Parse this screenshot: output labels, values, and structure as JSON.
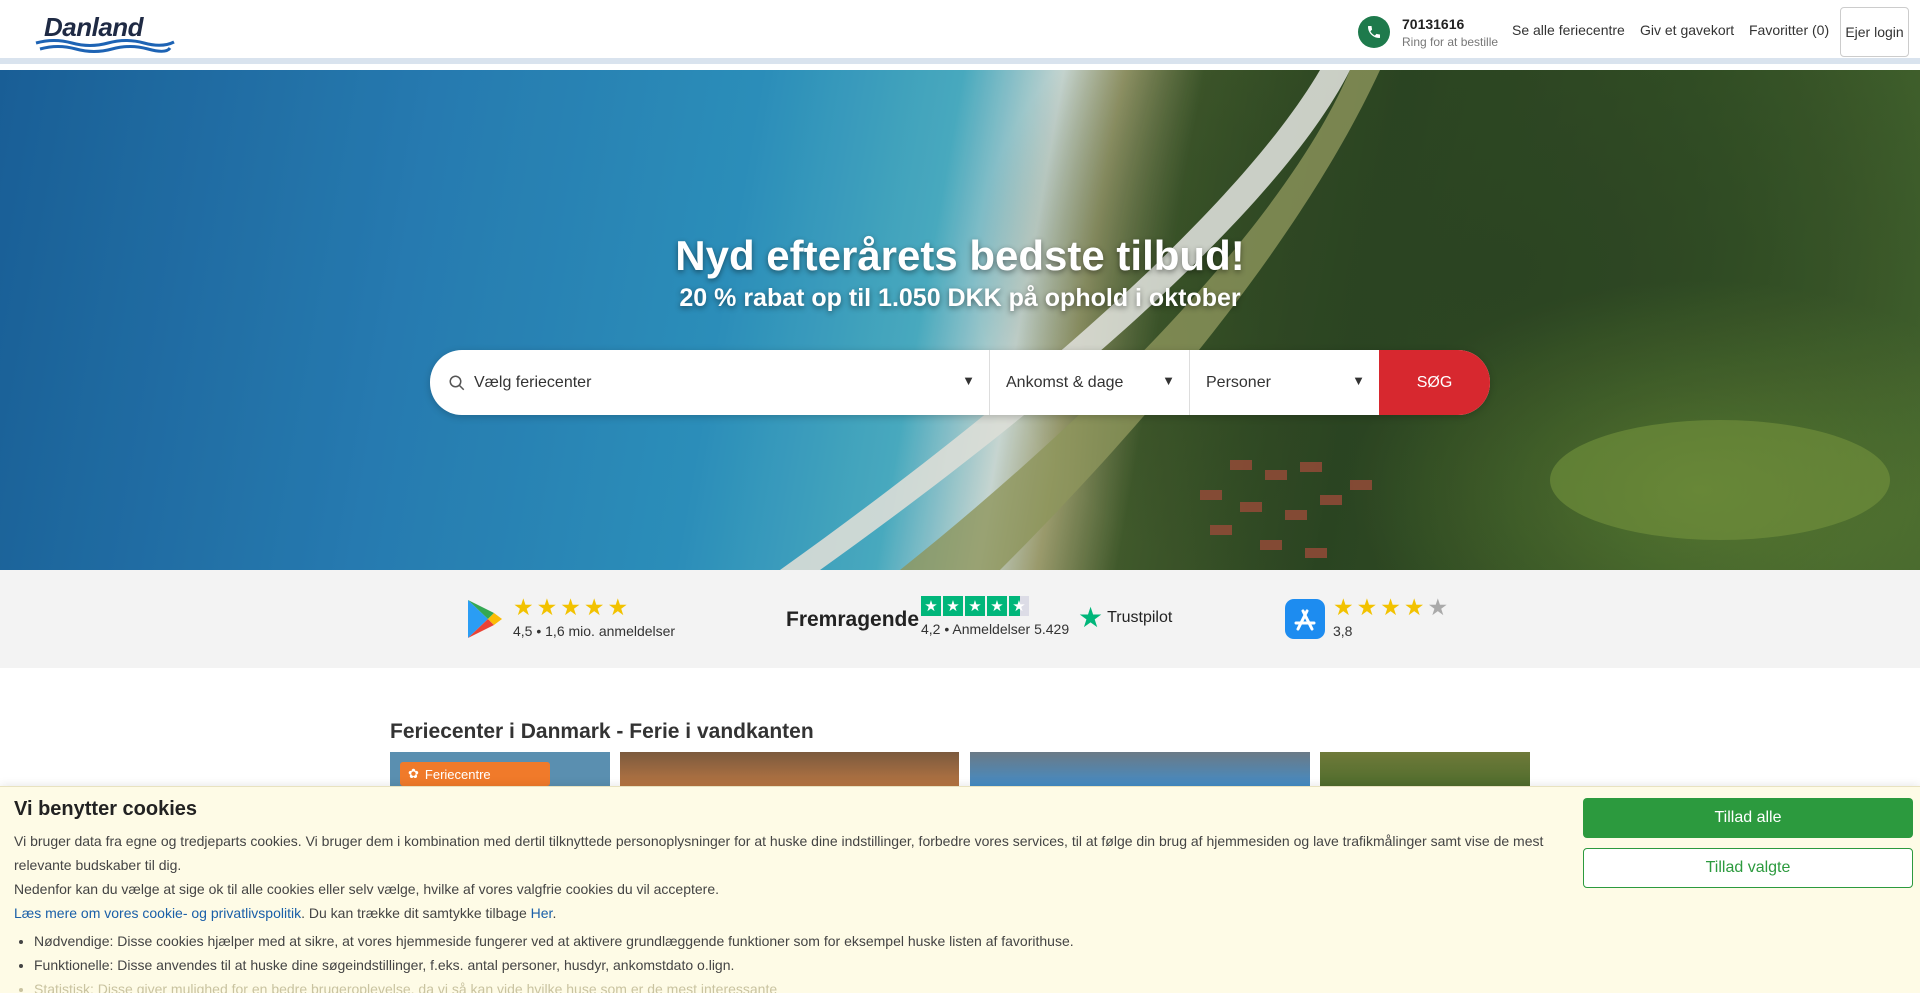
{
  "header": {
    "logo_text": "Danland",
    "phone": "70131616",
    "phone_sub": "Ring for at bestille",
    "nav": [
      "Se alle feriecentre",
      "Giv et gavekort",
      "Favoritter (0)"
    ],
    "login": "Ejer login"
  },
  "hero": {
    "title": "Nyd efterårets bedste tilbud!",
    "subtitle": "20 % rabat op til 1.050 DKK på ophold i oktober",
    "search": {
      "center_placeholder": "Vælg feriecenter",
      "date_placeholder": "Ankomst & dage",
      "persons_placeholder": "Personer",
      "button": "SØG"
    }
  },
  "ratings": {
    "google_play": {
      "meta": "4,5 • 1,6 mio. anmeldelser",
      "stars": 5
    },
    "trustpilot": {
      "word": "Fremragende",
      "meta": "4,2 • Anmeldelser 5.429",
      "brand": "Trustpilot",
      "stars": 4.5
    },
    "app_store": {
      "meta": "3,8",
      "stars": 4
    }
  },
  "section": {
    "title": "Feriecenter i Danmark - Ferie i vandkanten",
    "card_badge": "Feriecentre"
  },
  "cookie": {
    "title": "Vi benytter cookies",
    "p1": "Vi bruger data fra egne og tredjeparts cookies. Vi bruger dem i kombination med dertil tilknyttede personoplysninger for at huske dine indstillinger, forbedre vores services, til at følge din brug af hjemmesiden og lave trafikmålinger samt vise de mest relevante budskaber til dig.",
    "p2": "Nedenfor kan du vælge at sige ok til alle cookies eller selv vælge, hvilke af vores valgfrie cookies du vil acceptere.",
    "link1": "Læs mere om vores cookie- og privatlivspolitik",
    "p3_mid": ". Du kan trække dit samtykke tilbage ",
    "link2": "Her",
    "p3_end": ".",
    "items": [
      "Nødvendige: Disse cookies hjælper med at sikre, at vores hjemmeside fungerer ved at aktivere grundlæggende funktioner som for eksempel huske listen af favorithuse.",
      "Funktionelle: Disse anvendes til at huske dine søgeindstillinger, f.eks. antal personer, husdyr, ankomstdato o.lign.",
      "Statistisk: Disse giver mulighed for en bedre brugeroplevelse, da vi så kan vide hvilke huse som er de mest interessante"
    ],
    "allow_all": "Tillad alle",
    "allow_selected": "Tillad valgte"
  },
  "colors": {
    "accent_red": "#d7282f",
    "green": "#2c9a3e",
    "trustpilot": "#00b67a",
    "star": "#f2c200"
  }
}
